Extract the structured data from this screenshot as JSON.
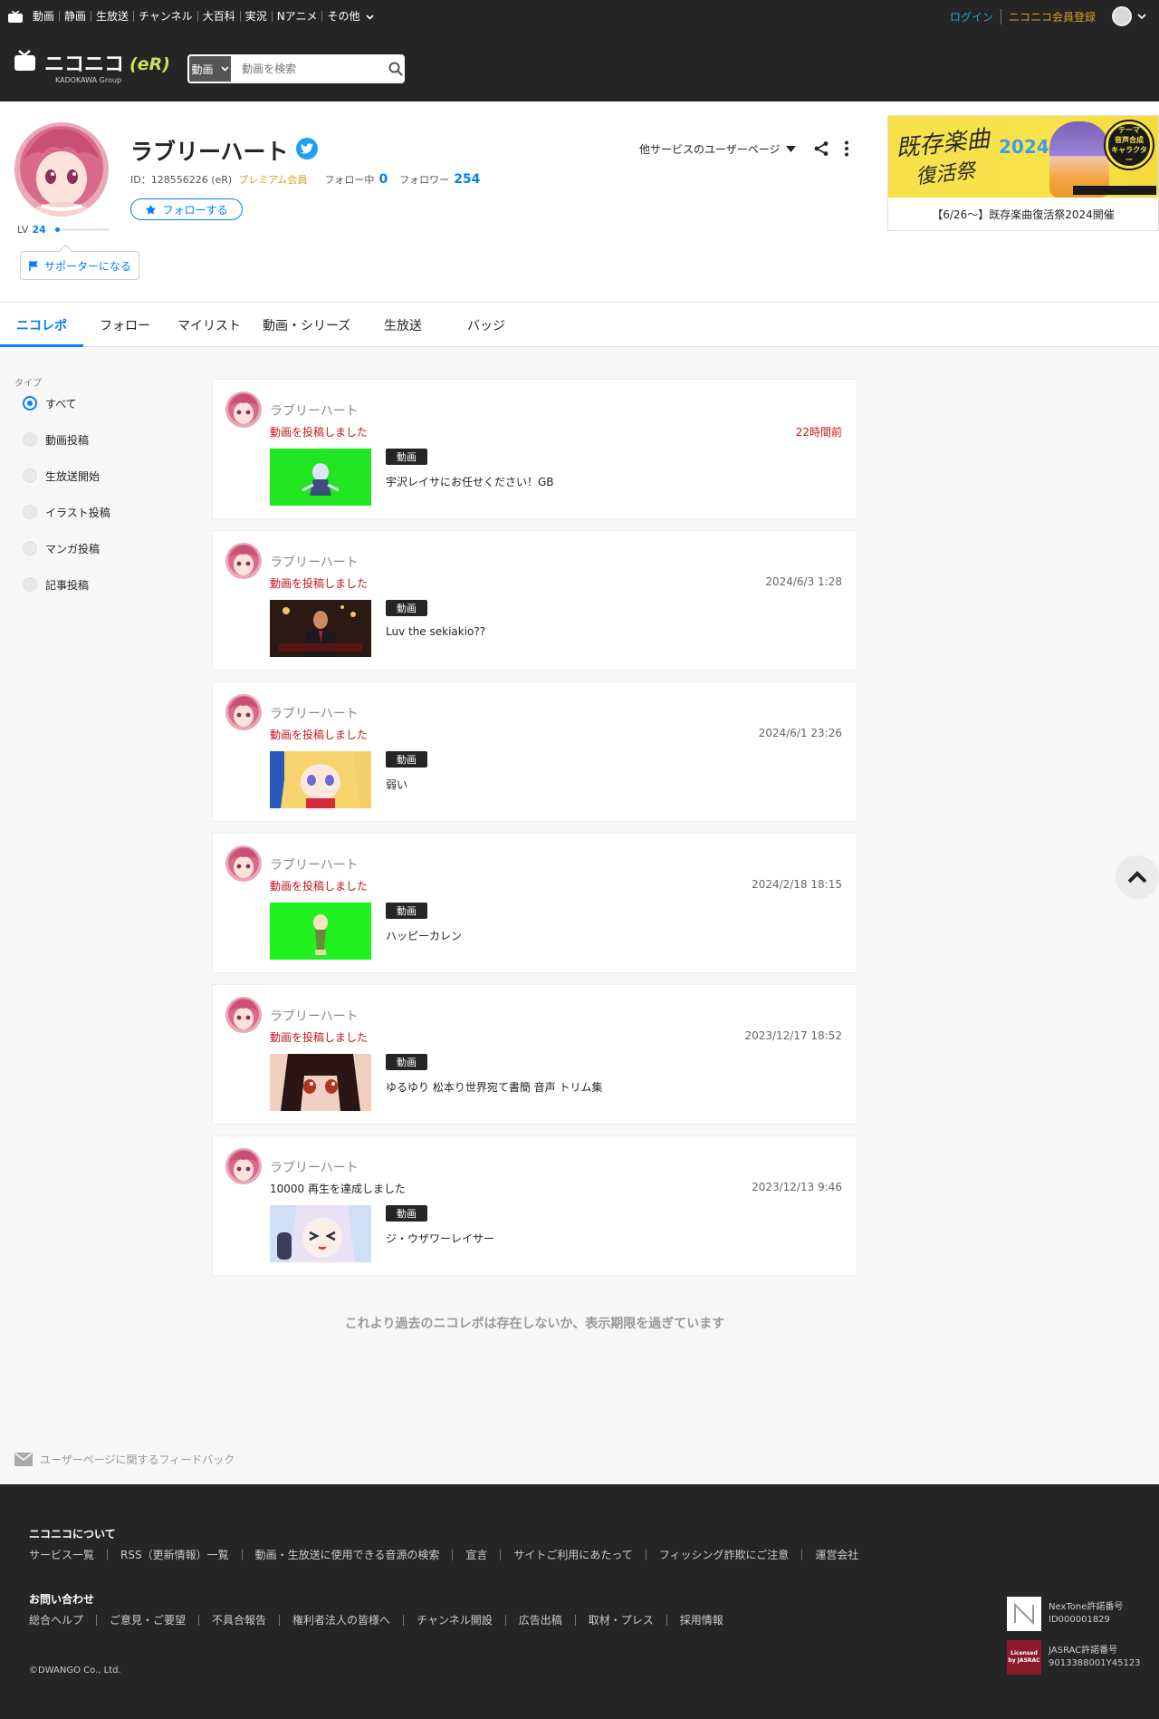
{
  "topnav": {
    "links": [
      "動画",
      "静画",
      "生放送",
      "チャンネル",
      "大百科",
      "実況",
      "Nアニメ",
      "その他"
    ],
    "login": "ログイン",
    "register": "ニコニコ会員登録"
  },
  "header": {
    "brand": "ニコニコ",
    "brand_er": "(eR)",
    "brand_sub": "KADOKAWA Group",
    "search_type": "動画",
    "search_placeholder": "動画を検索"
  },
  "profile": {
    "name": "ラブリーハート",
    "id_text": "ID：128556226 (eR)",
    "premium": "プレミアム会員",
    "following_label": "フォロー中",
    "following_count": "0",
    "followers_label": "フォロワー",
    "followers_count": "254",
    "follow_button": "フォローする",
    "level_label": "LV",
    "level": "24",
    "supporter_button": "サポーターになる",
    "other_services": "他サービスのユーザーページ"
  },
  "banner": {
    "art_title": "既存楽曲",
    "art_title2": "復活祭",
    "art_year": "2024",
    "art_badge": [
      "テーマ",
      "音声合成",
      "キャラクター"
    ],
    "caption": "【6/26〜】既存楽曲復活祭2024開催"
  },
  "tabs": [
    "ニコレポ",
    "フォロー",
    "マイリスト",
    "動画・シリーズ",
    "生放送",
    "バッジ"
  ],
  "filter": {
    "title": "タイプ",
    "options": [
      "すべて",
      "動画投稿",
      "生放送開始",
      "イラスト投稿",
      "マンガ投稿",
      "記事投稿"
    ]
  },
  "feed": [
    {
      "user": "ラブリーハート",
      "action": "動画を投稿しました",
      "time": "22時間前",
      "badge": "動画",
      "title": "宇沢レイサにお任せください！GB",
      "thumb_color": "#21e621"
    },
    {
      "user": "ラブリーハート",
      "action": "動画を投稿しました",
      "time": "2024/6/3 1:28",
      "badge": "動画",
      "title": "Luv the sekiakio??",
      "thumb_color": "#2b1a14"
    },
    {
      "user": "ラブリーハート",
      "action": "動画を投稿しました",
      "time": "2024/6/1 23:26",
      "badge": "動画",
      "title": "弱い",
      "thumb_color": "#f4cf6a"
    },
    {
      "user": "ラブリーハート",
      "action": "動画を投稿しました",
      "time": "2024/2/18 18:15",
      "badge": "動画",
      "title": "ハッピーカレン",
      "thumb_color": "#21f021"
    },
    {
      "user": "ラブリーハート",
      "action": "動画を投稿しました",
      "time": "2023/12/17 18:52",
      "badge": "動画",
      "title": "ゆるゆり 松本り世界宛て書簡 音声 トリム集",
      "thumb_color": "#3a1a1a"
    },
    {
      "user": "ラブリーハート",
      "action": "10000 再生を達成しました",
      "time": "2023/12/13 9:46",
      "badge": "動画",
      "title": "ジ・ウザワーレイサー",
      "thumb_color": "#c9d6ee"
    }
  ],
  "end_message": "これより過去のニコレポは存在しないか、表示期限を過ぎています",
  "feedback": "ユーザーページに関するフィードバック",
  "footer": {
    "about_title": "ニコニコについて",
    "about_links": [
      "サービス一覧",
      "RSS（更新情報）一覧",
      "動画・生放送に使用できる音源の検索",
      "宣言",
      "サイトご利用にあたって",
      "フィッシング詐欺にご注意",
      "運営会社"
    ],
    "contact_title": "お問い合わせ",
    "contact_links": [
      "総合ヘルプ",
      "ご意見・ご要望",
      "不具合報告",
      "権利者法人の皆様へ",
      "チャンネル開設",
      "広告出稿",
      "取材・プレス",
      "採用情報"
    ],
    "copyright": "©DWANGO Co., Ltd.",
    "nextone_label": "NexTone許諾番号",
    "nextone_id": "ID000001829",
    "jasrac_label": "JASRAC許諾番号",
    "jasrac_id": "9013388001Y45123",
    "jasrac_logo": "Licensed by JASRAC"
  },
  "colors": {
    "accent": "#0080ff",
    "header_bg": "#252525",
    "premium": "#d8a125",
    "action_red": "#c7141d"
  }
}
